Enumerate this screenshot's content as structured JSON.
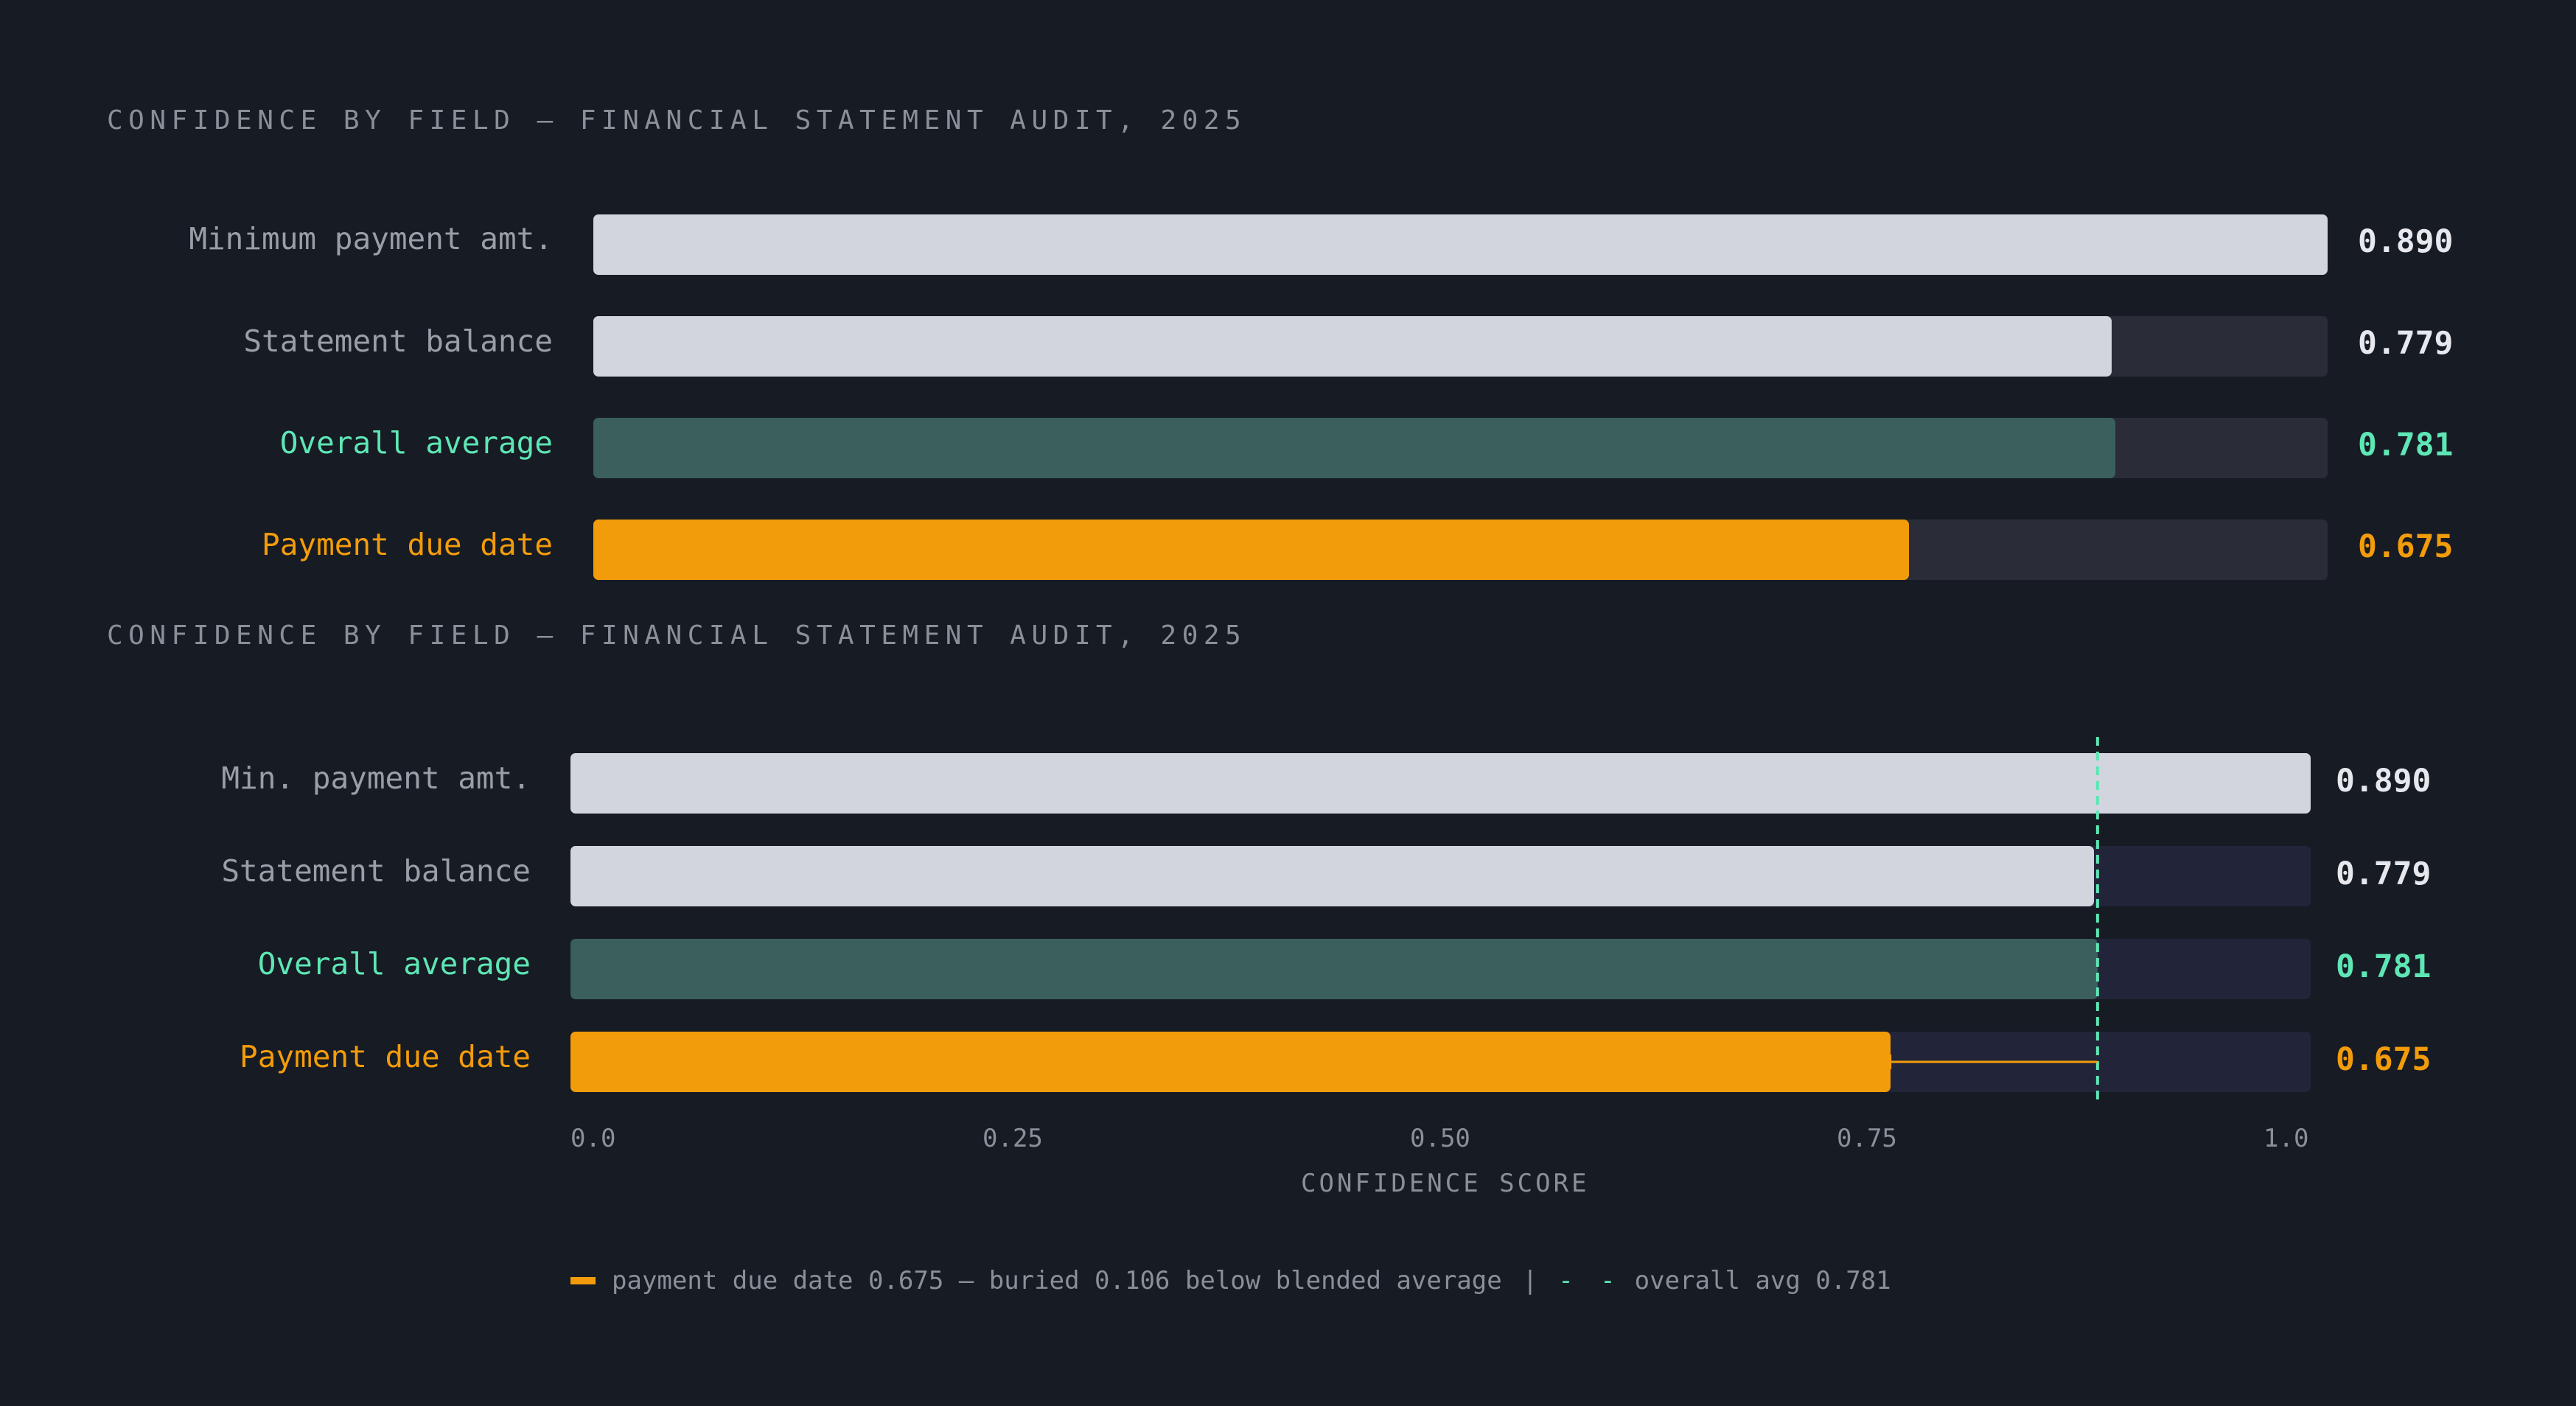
{
  "colors": {
    "background": "#171b23",
    "neutral_fill": "#d2d5de",
    "average_fill": "#3a5f5c",
    "highlight_fill": "#f39c0b",
    "track_panel1": "#2a2d37",
    "track_panel2": "#222539",
    "label_neutral": "#9a9ea7",
    "label_average": "#5ee6b5",
    "label_highlight": "#f39c0b",
    "value_neutral": "#e6e8ee",
    "reference_line": "#5ee6b5"
  },
  "chart_data": [
    {
      "type": "bar",
      "orientation": "horizontal",
      "title": "CONFIDENCE BY FIELD — FINANCIAL STATEMENT AUDIT, 2025",
      "categories": [
        "Minimum payment amt.",
        "Statement balance",
        "Overall average",
        "Payment due date"
      ],
      "values": [
        0.89,
        0.779,
        0.781,
        0.675
      ],
      "value_labels": [
        "0.890",
        "0.779",
        "0.781",
        "0.675"
      ],
      "xlim": [
        0,
        0.89
      ]
    },
    {
      "type": "bar",
      "orientation": "horizontal",
      "title": "CONFIDENCE BY FIELD — FINANCIAL STATEMENT AUDIT, 2025",
      "categories": [
        "Min. payment amt.",
        "Statement balance",
        "Overall average",
        "Payment due date"
      ],
      "values": [
        0.89,
        0.779,
        0.781,
        0.675
      ],
      "value_labels": [
        "0.890",
        "0.779",
        "0.781",
        "0.675"
      ],
      "xlim": [
        0,
        0.89
      ],
      "xlabel": "CONFIDENCE SCORE",
      "x_ticks": [
        "0.0",
        "0.25",
        "0.50",
        "0.75",
        "1.0"
      ],
      "reference_line": {
        "value": 0.781
      },
      "gap_annotation": {
        "from": 0.675,
        "to": 0.781
      },
      "legend": {
        "highlight_text": "payment due date 0.675 — buried 0.106 below blended average",
        "separator": "|",
        "dash_text": "- -",
        "average_text": "overall avg 0.781"
      }
    }
  ]
}
